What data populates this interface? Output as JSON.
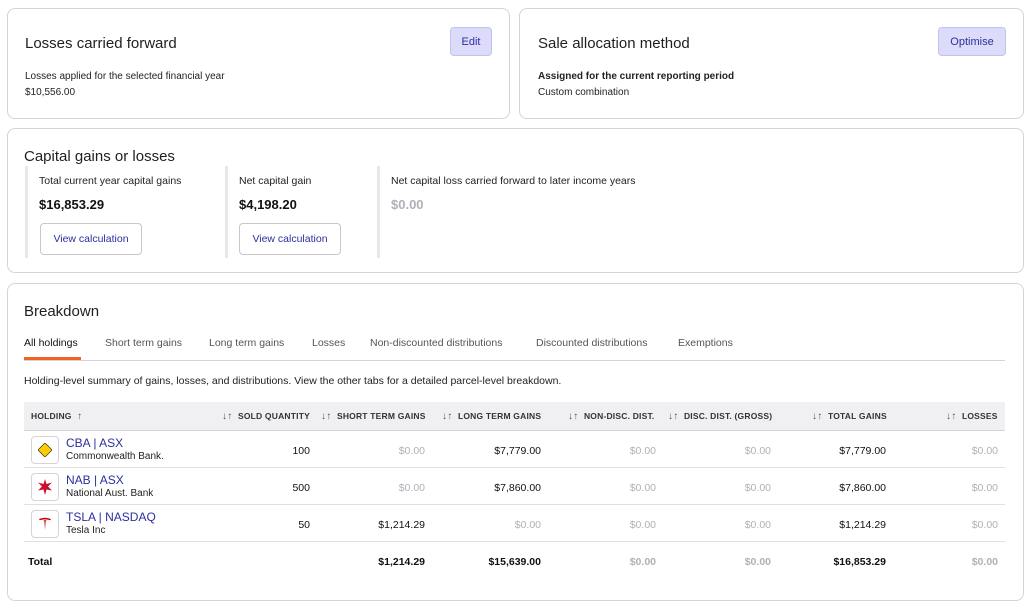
{
  "losses_card": {
    "title": "Losses carried forward",
    "edit_label": "Edit",
    "subtitle": "Losses applied for the selected financial year",
    "amount": "$10,556.00"
  },
  "sale_card": {
    "title": "Sale allocation method",
    "optimise_label": "Optimise",
    "subtitle": "Assigned for the current reporting period",
    "value": "Custom combination"
  },
  "capital": {
    "title": "Capital gains or losses",
    "cols": [
      {
        "label": "Total current year capital gains",
        "value": "$16,853.29",
        "button": "View calculation"
      },
      {
        "label": "Net capital gain",
        "value": "$4,198.20",
        "button": "View calculation"
      },
      {
        "label": "Net capital loss carried forward to later income years",
        "value": "$0.00"
      }
    ]
  },
  "breakdown": {
    "title": "Breakdown",
    "tabs": [
      "All holdings",
      "Short term gains",
      "Long term gains",
      "Losses",
      "Non-discounted distributions",
      "Discounted distributions",
      "Exemptions"
    ],
    "description": "Holding-level summary of gains, losses, and distributions. View the other tabs for a detailed parcel-level breakdown.",
    "headers": {
      "holding": "HOLDING",
      "sold_quantity": "SOLD QUANTITY",
      "short_term": "SHORT TERM GAINS",
      "long_term": "LONG TERM GAINS",
      "non_disc": "NON-DISC. DIST.",
      "disc": "DISC. DIST. (GROSS)",
      "total": "TOTAL GAINS",
      "losses": "LOSSES"
    },
    "rows": [
      {
        "ticker": "CBA | ASX",
        "company": "Commonwealth Bank.",
        "qty": "100",
        "short": "$0.00",
        "long": "$7,779.00",
        "nondisc": "$0.00",
        "disc": "$0.00",
        "total": "$7,779.00",
        "losses": "$0.00"
      },
      {
        "ticker": "NAB | ASX",
        "company": "National Aust. Bank",
        "qty": "500",
        "short": "$0.00",
        "long": "$7,860.00",
        "nondisc": "$0.00",
        "disc": "$0.00",
        "total": "$7,860.00",
        "losses": "$0.00"
      },
      {
        "ticker": "TSLA | NASDAQ",
        "company": "Tesla Inc",
        "qty": "50",
        "short": "$1,214.29",
        "long": "$0.00",
        "nondisc": "$0.00",
        "disc": "$0.00",
        "total": "$1,214.29",
        "losses": "$0.00"
      }
    ],
    "total": {
      "label": "Total",
      "short": "$1,214.29",
      "long": "$15,639.00",
      "nondisc": "$0.00",
      "disc": "$0.00",
      "total": "$16,853.29",
      "losses": "$0.00"
    }
  },
  "colors": {
    "accent": "#f26322",
    "link": "#2b2f9e",
    "button_bg": "#dcdcfa",
    "cba_yellow": "#ffcc00",
    "nab_red": "#c8102e",
    "tesla_red": "#cc0000"
  },
  "icons": {
    "sort_asc": "arrow-up-icon",
    "sort": "sort-arrows-icon"
  }
}
